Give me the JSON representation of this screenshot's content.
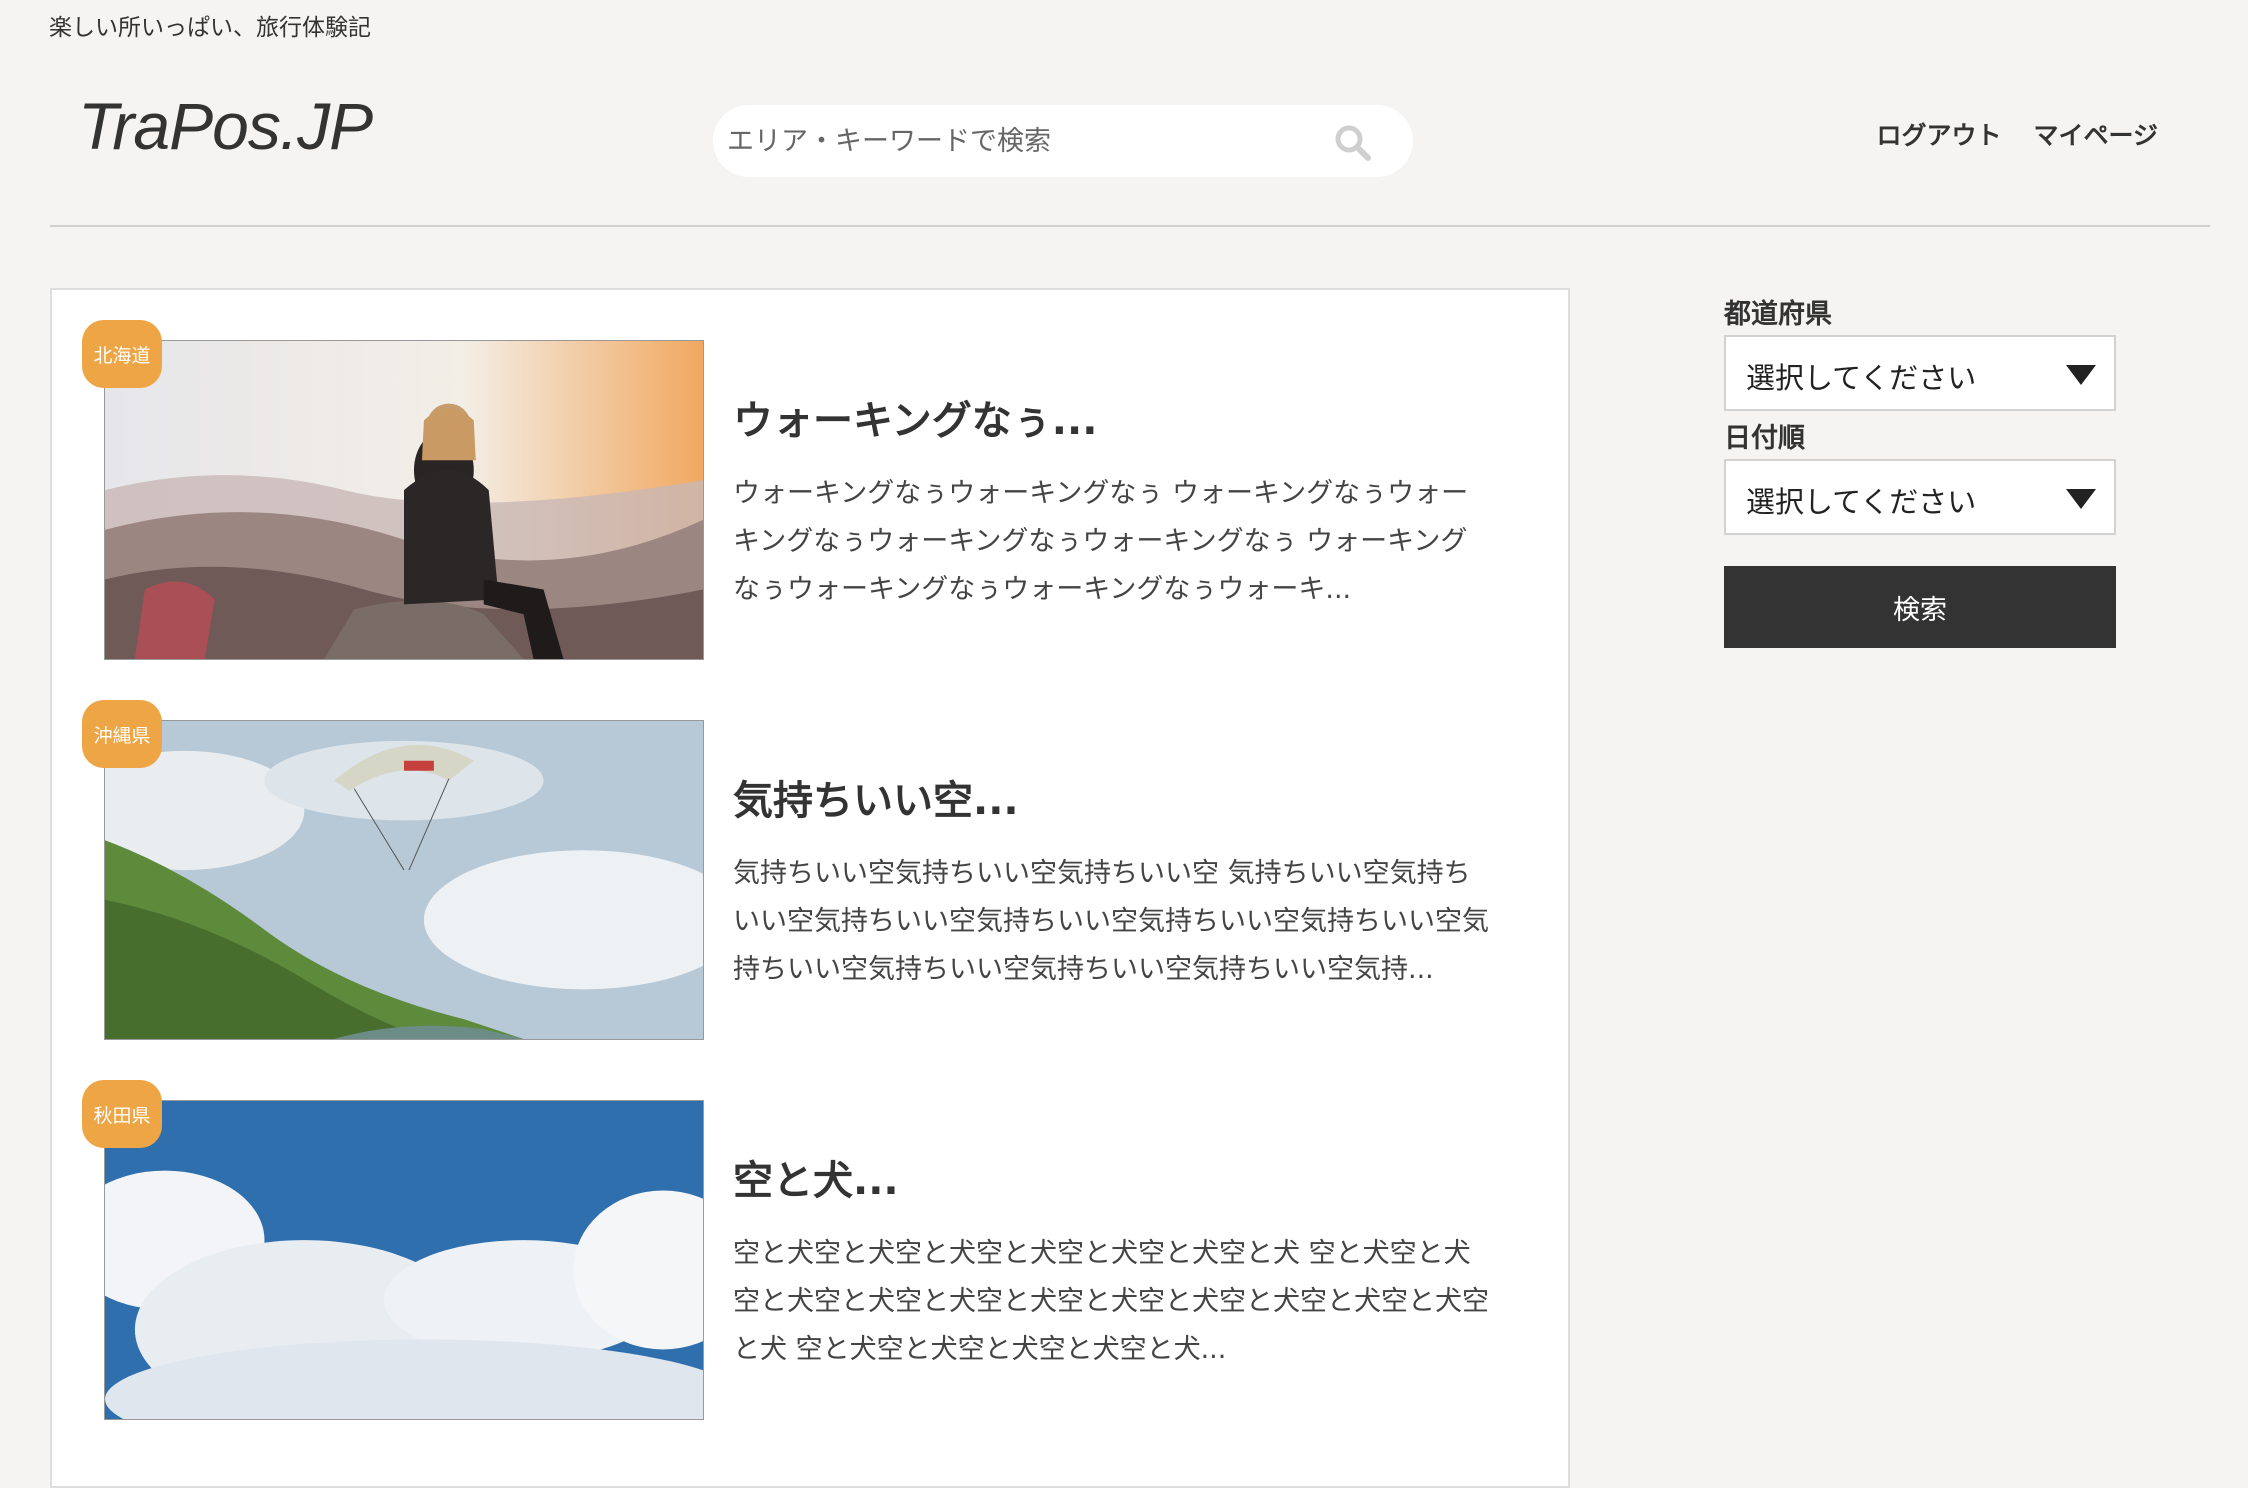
{
  "header": {
    "tagline": "楽しい所いっぱい、旅行体験記",
    "logo": "TraPos.JP",
    "search_placeholder": "エリア・キーワードで検索",
    "nav": [
      "ログアウト",
      "マイページ"
    ]
  },
  "posts": [
    {
      "badge": "北海道",
      "title": "ウォーキングなぅ...",
      "excerpt_lines": [
        "ウォーキングなぅウォーキングなぅ ウォーキングなぅウォー",
        "キングなぅウォーキングなぅウォーキングなぅ ウォーキング",
        "なぅウォーキングなぅウォーキングなぅウォーキ..."
      ],
      "image": "woman-sitting-on-mountain"
    },
    {
      "badge": "沖縄県",
      "title": "気持ちいい空...",
      "excerpt_lines": [
        "気持ちいい空気持ちいい空気持ちいい空 気持ちいい空気持ち",
        "いい空気持ちいい空気持ちいい空気持ちいい空気持ちいい空気",
        "持ちいい空気持ちいい空気持ちいい空気持ちいい空気持..."
      ],
      "image": "paraglider-over-green-hill"
    },
    {
      "badge": "秋田県",
      "title": "空と犬...",
      "excerpt_lines": [
        "空と犬空と犬空と犬空と犬空と犬空と犬空と犬 空と犬空と犬",
        "空と犬空と犬空と犬空と犬空と犬空と犬空と犬空と犬空と犬空",
        "と犬 空と犬空と犬空と犬空と犬空と犬..."
      ],
      "image": "blue-sky-with-clouds"
    }
  ],
  "sidebar": {
    "prefecture_label": "都道府県",
    "prefecture_value": "選択してください",
    "date_label": "日付順",
    "date_value": "選択してください",
    "submit_label": "検索"
  },
  "colors": {
    "background": "#f5f4f2",
    "badge": "#eea545",
    "button": "#333333"
  }
}
